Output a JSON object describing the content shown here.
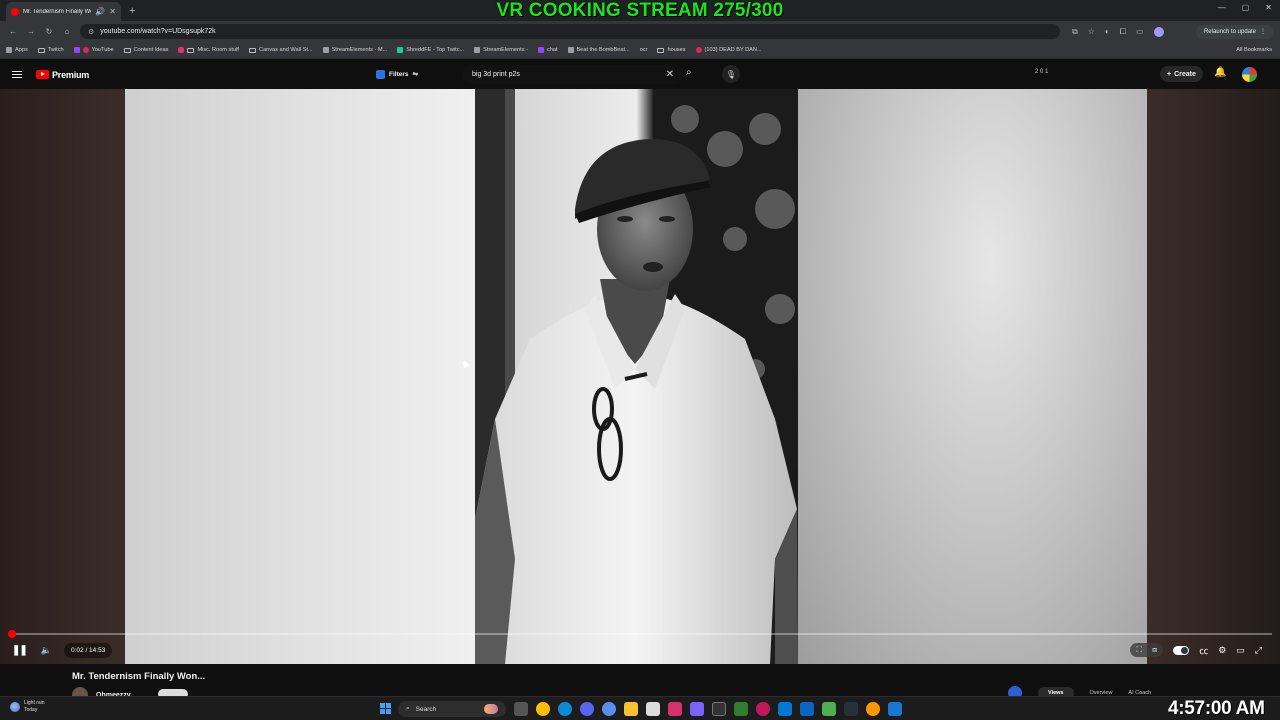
{
  "stream_overlay": {
    "title": "VR COOKING STREAM 275/300"
  },
  "browser": {
    "tab_title": "Mr. Tendernism Finally Wo",
    "new_tab_symbol": "+",
    "address": "youtube.com/watch?v=UDsgsupk72k",
    "relaunch_label": "Relaunch to update",
    "all_bookmarks_label": "All Bookmarks",
    "bookmarks": [
      {
        "label": "Apps",
        "icon": "apps-grid-icon"
      },
      {
        "label": "Twitch",
        "icon": "folder-icon"
      },
      {
        "label": "YouTube",
        "icon": "youtube-icon"
      },
      {
        "label": "Content Ideas",
        "icon": "folder-icon"
      },
      {
        "label": "Misc. Room stuff",
        "icon": "folder-icon"
      },
      {
        "label": "Canvas and Wall St...",
        "icon": "folder-icon"
      },
      {
        "label": "StreamElements - M...",
        "icon": "streamelements-icon"
      },
      {
        "label": "ShreddFE - Top Twitc...",
        "icon": "tt-icon"
      },
      {
        "label": "StreamElements -",
        "icon": "streamelements-icon"
      },
      {
        "label": "chat",
        "icon": "twitch-icon"
      },
      {
        "label": "Beat the BombBeat...",
        "icon": "globe-icon"
      },
      {
        "label": "ocr",
        "icon": "globe-icon"
      },
      {
        "label": "houses",
        "icon": "folder-icon"
      },
      {
        "label": "(103) DEAD BY DAN...",
        "icon": "youtube-icon"
      }
    ]
  },
  "youtube": {
    "brand": "Premium",
    "filters_label": "Filters",
    "search_query": "big 3d print p2s",
    "ext_counters": "2 0 1",
    "create_label": "Create",
    "video": {
      "current_time": "0:02",
      "duration": "14:53",
      "time_display": "0:02 / 14:53",
      "progress_fraction": 0.0022,
      "title": "Mr. Tendernism Finally Won...",
      "channel": "Ohmeezzy"
    },
    "bottom_tabs": [
      "Views",
      "Overview",
      "AI Coach"
    ]
  },
  "taskbar": {
    "weather_line1": "Light rain",
    "weather_line2": "Today",
    "search_label": "Search",
    "clock": "4:57:00 AM"
  },
  "colors": {
    "overlay_green": "#19e61e",
    "youtube_red": "#ff0000",
    "windows_blue": "#3ea0ff"
  }
}
